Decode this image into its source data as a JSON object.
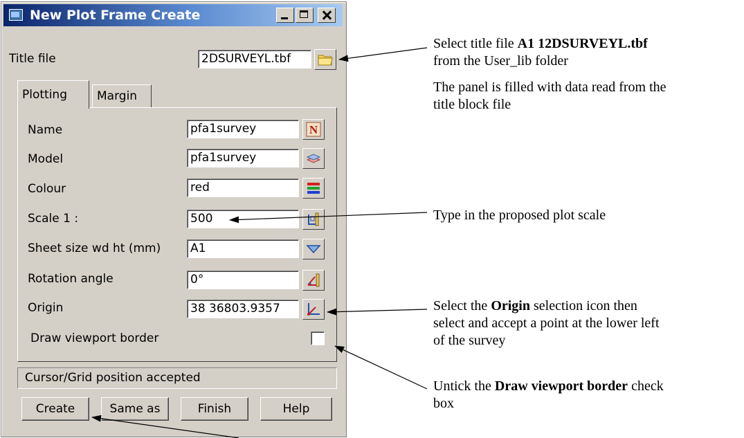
{
  "window": {
    "title": "New Plot Frame Create",
    "title_file_label": "Title file",
    "title_file_value": "2DSURVEYL.tbf"
  },
  "tabs": [
    {
      "label": "Plotting",
      "active": true
    },
    {
      "label": "Margin",
      "active": false
    }
  ],
  "fields": {
    "name": {
      "label": "Name",
      "value": "pfa1survey",
      "icon": "n-icon"
    },
    "model": {
      "label": "Model",
      "value": "pfa1survey",
      "icon": "layers-icon"
    },
    "colour": {
      "label": "Colour",
      "value": "red",
      "icon": "colour-bars-icon"
    },
    "scale": {
      "label": "Scale 1 :",
      "value": "500",
      "icon": "scale-pick-icon"
    },
    "sheet_size": {
      "label": "Sheet size wd ht (mm)",
      "value": "A1",
      "icon": "chevron-down-icon"
    },
    "rotation": {
      "label": "Rotation angle",
      "value": "0°",
      "icon": "angle-pick-icon"
    },
    "origin": {
      "label": "Origin",
      "value": "38 36803.9357",
      "icon": "origin-pick-icon"
    }
  },
  "checkbox": {
    "label": "Draw viewport border",
    "checked": false
  },
  "status": "Cursor/Grid position accepted",
  "buttons": {
    "create": "Create",
    "same_as": "Same as",
    "finish": "Finish",
    "help": "Help"
  },
  "annotations": {
    "title_file": {
      "prefix": "Select title file ",
      "bold": "A1 12DSURVEYL.tbf",
      "line2": "from the User_lib folder"
    },
    "panel_filled": {
      "line1": "The panel is filled with data read from the",
      "line2": "title block file"
    },
    "scale": "Type in the proposed plot scale",
    "origin": {
      "prefix": "Select the ",
      "bold": "Origin",
      "suffix": " selection icon then",
      "line2": "select and accept a point at the lower left",
      "line3": "of the survey"
    },
    "untick": {
      "prefix": "Untick the ",
      "bold": "Draw viewport border",
      "suffix": " check",
      "line2": "box"
    }
  },
  "colors": {
    "titlebar_start": "#0a246a",
    "titlebar_end": "#a6caf0",
    "dialog_bg": "#d4d0c8"
  }
}
